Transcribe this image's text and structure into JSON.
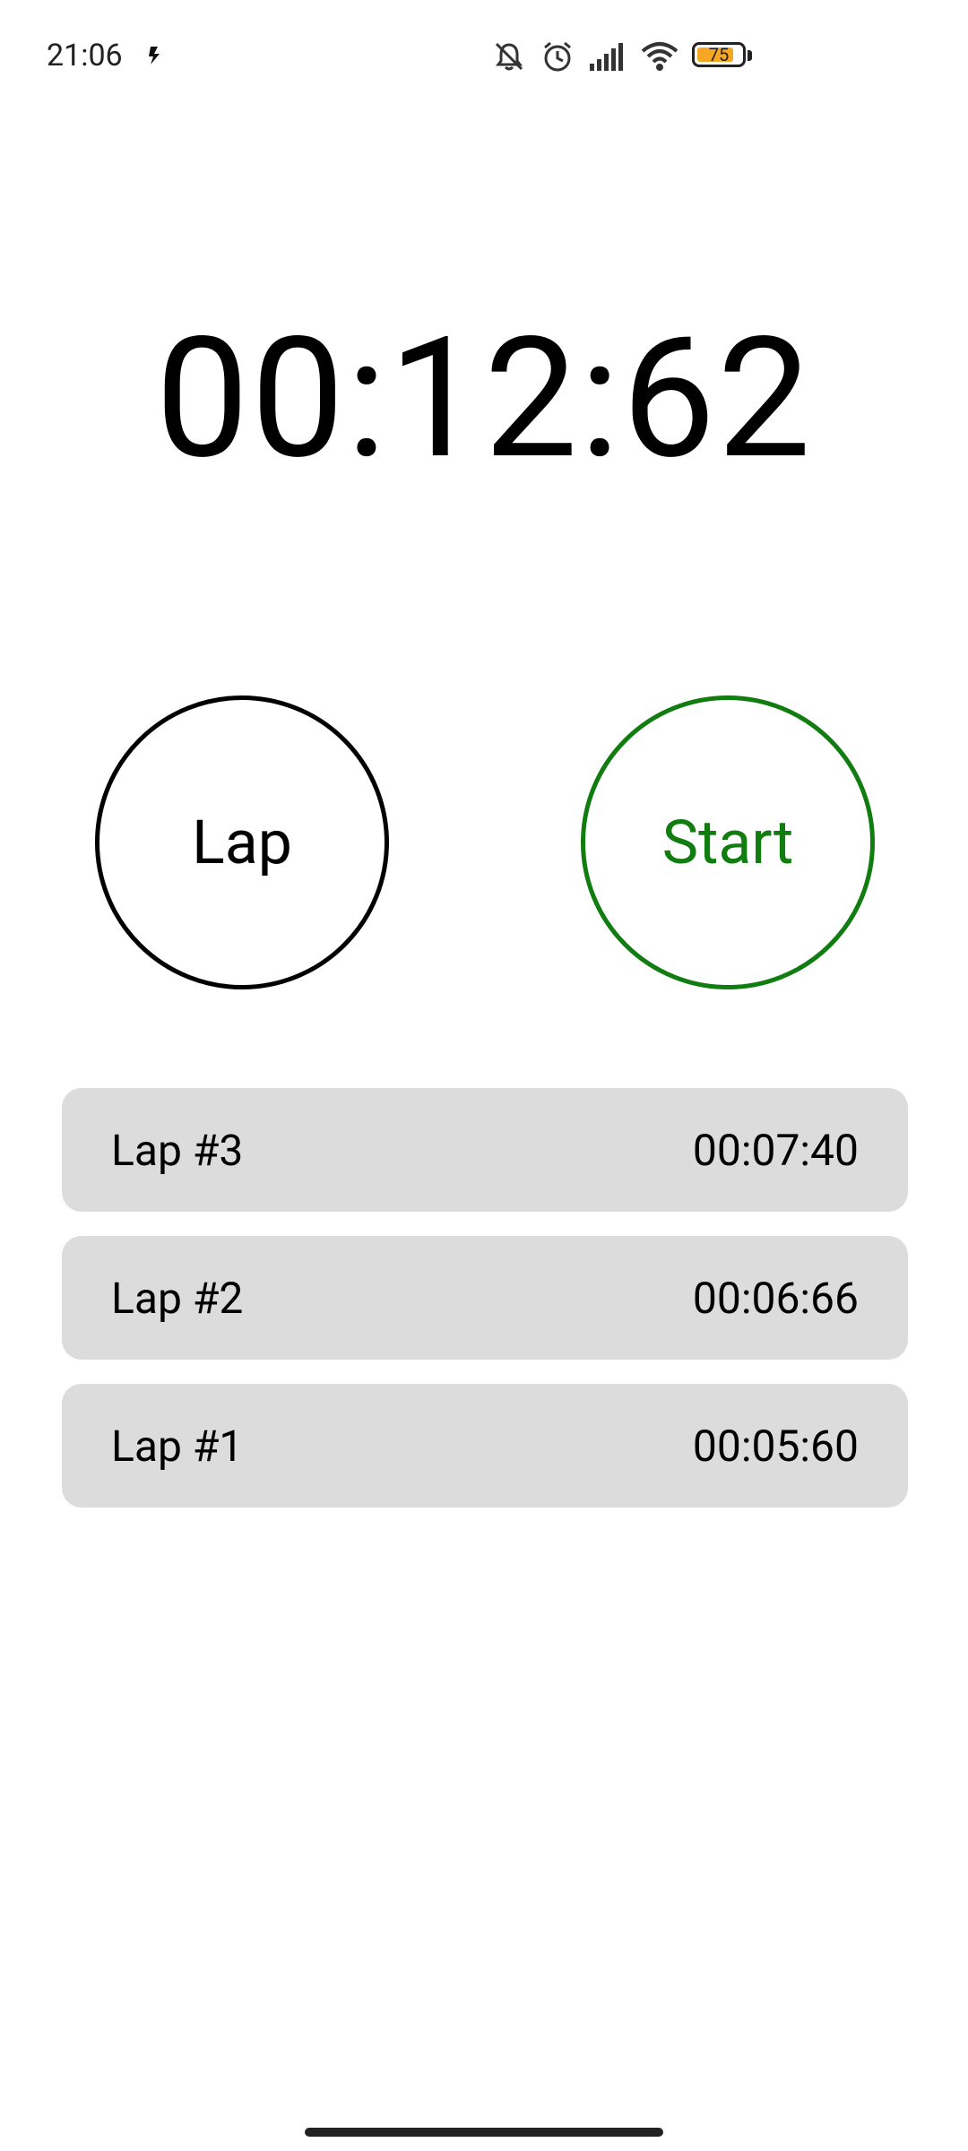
{
  "status_bar": {
    "time": "21:06",
    "battery_level": "75",
    "icons": [
      "app-notification-icon",
      "mute-icon",
      "alarm-icon",
      "signal-icon",
      "wifi-icon",
      "battery-icon"
    ]
  },
  "stopwatch": {
    "elapsed": "00:12:62",
    "lap_button_label": "Lap",
    "start_button_label": "Start",
    "start_color": "#117d11",
    "laps": [
      {
        "label": "Lap #3",
        "time": "00:07:40"
      },
      {
        "label": "Lap #2",
        "time": "00:06:66"
      },
      {
        "label": "Lap #1",
        "time": "00:05:60"
      }
    ]
  }
}
